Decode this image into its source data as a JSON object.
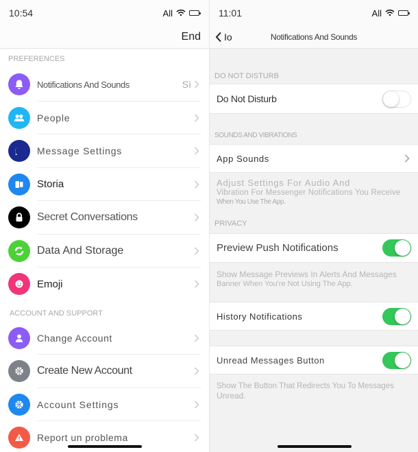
{
  "left": {
    "status": {
      "time": "10:54",
      "carrier": "All"
    },
    "nav": {
      "right_button": "End"
    },
    "sections": [
      {
        "label": "PREFERENCES",
        "items": [
          {
            "label": "Notifications And Sounds",
            "value": "Sì",
            "icon": "bell-icon",
            "color": "#8b5cf6"
          },
          {
            "label": "People",
            "icon": "people-icon",
            "color": "#1fb6f5"
          },
          {
            "label": "Message Settings",
            "icon": "message-bubble-icon",
            "color": "#1a2a8f"
          },
          {
            "label": "Storia",
            "icon": "stories-icon",
            "color": "#1f87f0"
          },
          {
            "label": "Secret Conversations",
            "icon": "lock-icon",
            "color": "#000000"
          },
          {
            "label": "Data And Storage",
            "icon": "data-storage-icon",
            "color": "#4cd137"
          },
          {
            "label": "Emoji",
            "icon": "smiley-icon",
            "color": "#f0357a"
          }
        ]
      },
      {
        "label": "ACCOUNT AND SUPPORT",
        "items": [
          {
            "label": "Change Account",
            "icon": "person-icon",
            "color": "#8b5cf6"
          },
          {
            "label": "Create New Account",
            "icon": "gear-icon",
            "color": "#7d8289"
          },
          {
            "label": "Account Settings",
            "icon": "gear-icon",
            "color": "#1f87f0"
          },
          {
            "label": "Report un problema",
            "icon": "warning-icon",
            "color": "#f25a47"
          }
        ]
      }
    ]
  },
  "right": {
    "status": {
      "time": "11:01",
      "carrier": "All"
    },
    "nav": {
      "back_label": "Io",
      "title": "Notifications And Sounds"
    },
    "dnd": {
      "section": "DO NOT DISTURB",
      "label": "Do Not Disturb",
      "on": false
    },
    "sounds": {
      "section": "SOUNDS AND VIBRATIONS",
      "label": "App Sounds",
      "desc1": "Adjust Settings For Audio And",
      "desc2": "Vibration For Messenger Notifications You Receive",
      "desc3": "When You Use The App."
    },
    "privacy": {
      "section": "PRIVACY",
      "preview_label": "Preview Push Notifications",
      "preview_on": true,
      "preview_desc1": "Show Message Previews In Alerts And Messages",
      "preview_desc2": "Banner When You're Not Using The App.",
      "history_label": "History Notifications",
      "history_on": true,
      "unread_label": "Unread Messages Button",
      "unread_on": true,
      "unread_desc1": "Show The Button That Redirects You To Messages",
      "unread_desc2": "Unread."
    }
  }
}
